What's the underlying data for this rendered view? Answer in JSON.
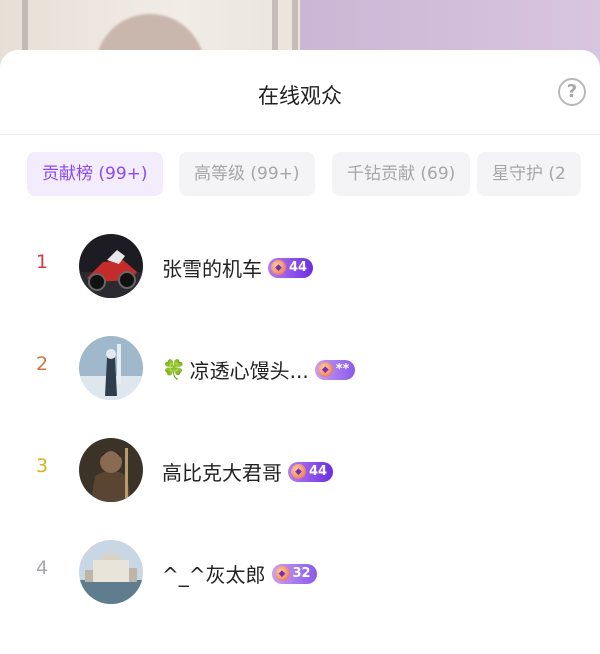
{
  "header": {
    "title": "在线观众",
    "help_icon": "?"
  },
  "tabs": [
    {
      "label": "贡献榜 (99+)",
      "active": true
    },
    {
      "label": "高等级 (99+)",
      "active": false
    },
    {
      "label": "千钻贡献 (69)",
      "active": false
    },
    {
      "label": "星守护 (2",
      "active": false
    }
  ],
  "viewers": [
    {
      "rank": "1",
      "name": "张雪的机车",
      "prefix_icon": "",
      "badge": "44",
      "rank_color": "#d23a4f"
    },
    {
      "rank": "2",
      "name": "凉透心馒头...",
      "prefix_icon": "🍀",
      "badge": "**",
      "rank_color": "#d0773c"
    },
    {
      "rank": "3",
      "name": "高比克大君哥",
      "prefix_icon": "",
      "badge": "44",
      "rank_color": "#d9b21c"
    },
    {
      "rank": "4",
      "name": "^_^灰太郎",
      "prefix_icon": "",
      "badge": "32",
      "rank_color": "#a7a7ad"
    }
  ]
}
